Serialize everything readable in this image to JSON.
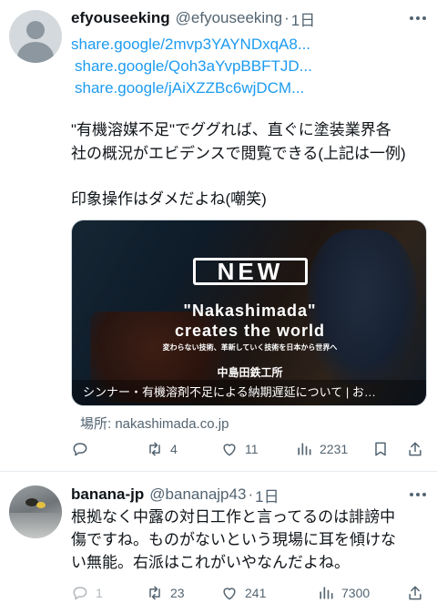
{
  "posts": [
    {
      "author": {
        "name": "efyouseeking",
        "handle": "@efyouseeking",
        "time": "1日"
      },
      "links": [
        "share.google/2mvp3YAYNDxqA8...",
        "share.google/Qoh3aYvpBBFTJD...",
        "share.google/jAiXZZBc6wjDCM..."
      ],
      "paragraph1": "\"有機溶媒不足\"でググれば、直ぐに塗装業界各\n社の概況がエビデンスで閲覧できる(上記は一例)",
      "paragraph2": "印象操作はダメだよね(嘲笑)",
      "card": {
        "logo": "NEW",
        "headline1": "\"Nakashimada\"",
        "headline2": "creates the world",
        "tagline": "変わらない技術、革新していく技術を日本から世界へ",
        "company": "中島田鉄工所",
        "title": "シンナー・有機溶剤不足による納期遅延について | お…"
      },
      "source": "場所: nakashimada.co.jp",
      "stats": {
        "replies": "",
        "reposts": "4",
        "likes": "11",
        "views": "2231"
      }
    },
    {
      "author": {
        "name": "banana-jp",
        "handle": "@bananajp43",
        "time": "1日"
      },
      "text": "根拠なく中露の対日工作と言ってるのは誹謗中\n傷ですね。ものがないという現場に耳を傾けな\nい無能。右派はこれがいやなんだよね。",
      "stats": {
        "replies": "1",
        "reposts": "23",
        "likes": "241",
        "views": "7300"
      }
    }
  ],
  "icons": {
    "more": "more-horizontal-icon",
    "reply": "reply-icon",
    "repost": "repost-icon",
    "like": "heart-icon",
    "views": "views-bar-icon",
    "bookmark": "bookmark-icon",
    "share": "share-icon"
  },
  "colors": {
    "link": "#1d9bf0",
    "muted": "#536471",
    "text": "#0f1419"
  }
}
